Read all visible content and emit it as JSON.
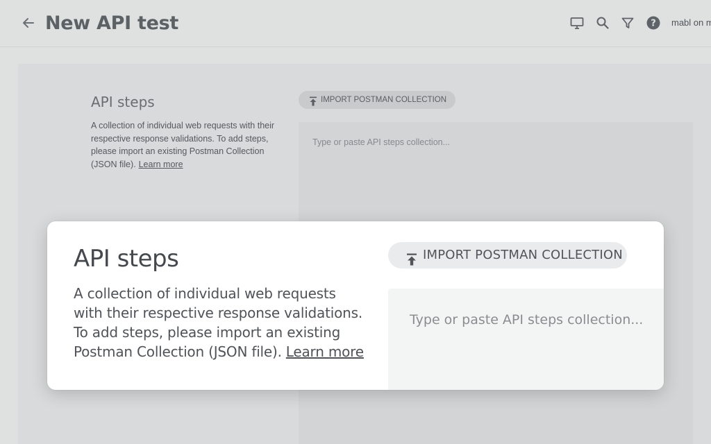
{
  "header": {
    "title": "New API test",
    "user": "mabl on m",
    "icons": [
      "monitor-icon",
      "search-icon",
      "filter-icon",
      "help-icon"
    ]
  },
  "background_section": {
    "heading": "API steps",
    "description": "A collection of individual web requests with their respective response validations. To add steps, please import an existing Postman Collection (JSON file).",
    "learn_more": "Learn more",
    "import_button": "IMPORT POSTMAN COLLECTION",
    "placeholder": "Type or paste API steps collection..."
  },
  "card": {
    "heading": "API steps",
    "description": "A collection of individual web requests with their respective response validations. To add steps, please import an existing Postman Collection (JSON file).",
    "learn_more": "Learn more",
    "import_button": "IMPORT POSTMAN COLLECTION",
    "placeholder": "Type or paste API steps collection..."
  }
}
